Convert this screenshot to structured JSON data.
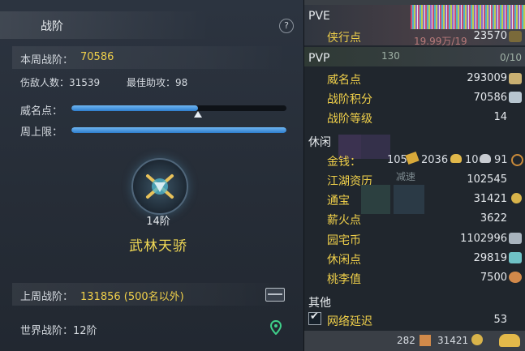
{
  "left": {
    "title": "战阶",
    "help": "?",
    "week_rank_label": "本周战阶：",
    "week_rank_value": "70586",
    "kills": "伤敌人数：31539",
    "assists": "最佳助攻：98",
    "prestige_label": "威名点：",
    "prestige_progress": 0.59,
    "week_cap_label": "周上限：",
    "week_cap_progress": 1.0,
    "rank_level": "14阶",
    "rank_name": "武林天骄",
    "last_week_label": "上周战阶：",
    "last_week_value": "131856 (500名以外)",
    "world_rank": "世界战阶：12阶"
  },
  "right": {
    "pve_header": "PVE",
    "pve_items": [
      {
        "label": "侠行点",
        "value": "23570"
      }
    ],
    "bg_texts": [
      "19.99万/19",
      "130",
      "0/10",
      "减速"
    ],
    "pvp_header": "PVP",
    "pvp_items": [
      {
        "label": "威名点",
        "value": "293009"
      },
      {
        "label": "战阶积分",
        "value": "70586"
      },
      {
        "label": "战阶等级",
        "value": "14"
      }
    ],
    "leisure_header": "休闲",
    "money": {
      "label": "金钱：",
      "v1": "105",
      "v2": "2036",
      "v3": "10",
      "v4": "91"
    },
    "leisure_items": [
      {
        "label": "江湖资历",
        "value": "102545"
      },
      {
        "label": "通宝",
        "value": "31421"
      },
      {
        "label": "薪火点",
        "value": "3622"
      },
      {
        "label": "园宅币",
        "value": "1102996"
      },
      {
        "label": "休闲点",
        "value": "29819"
      },
      {
        "label": "桃李值",
        "value": "7500"
      }
    ],
    "other_header": "其他",
    "other_items": [
      {
        "label": "网络延迟",
        "value": "53"
      }
    ],
    "bottom": {
      "count1": "282",
      "count2": "31421"
    }
  },
  "colors": {
    "gold": "#f0d04a",
    "bar": "#3f90dc",
    "panel": "#262d37"
  }
}
